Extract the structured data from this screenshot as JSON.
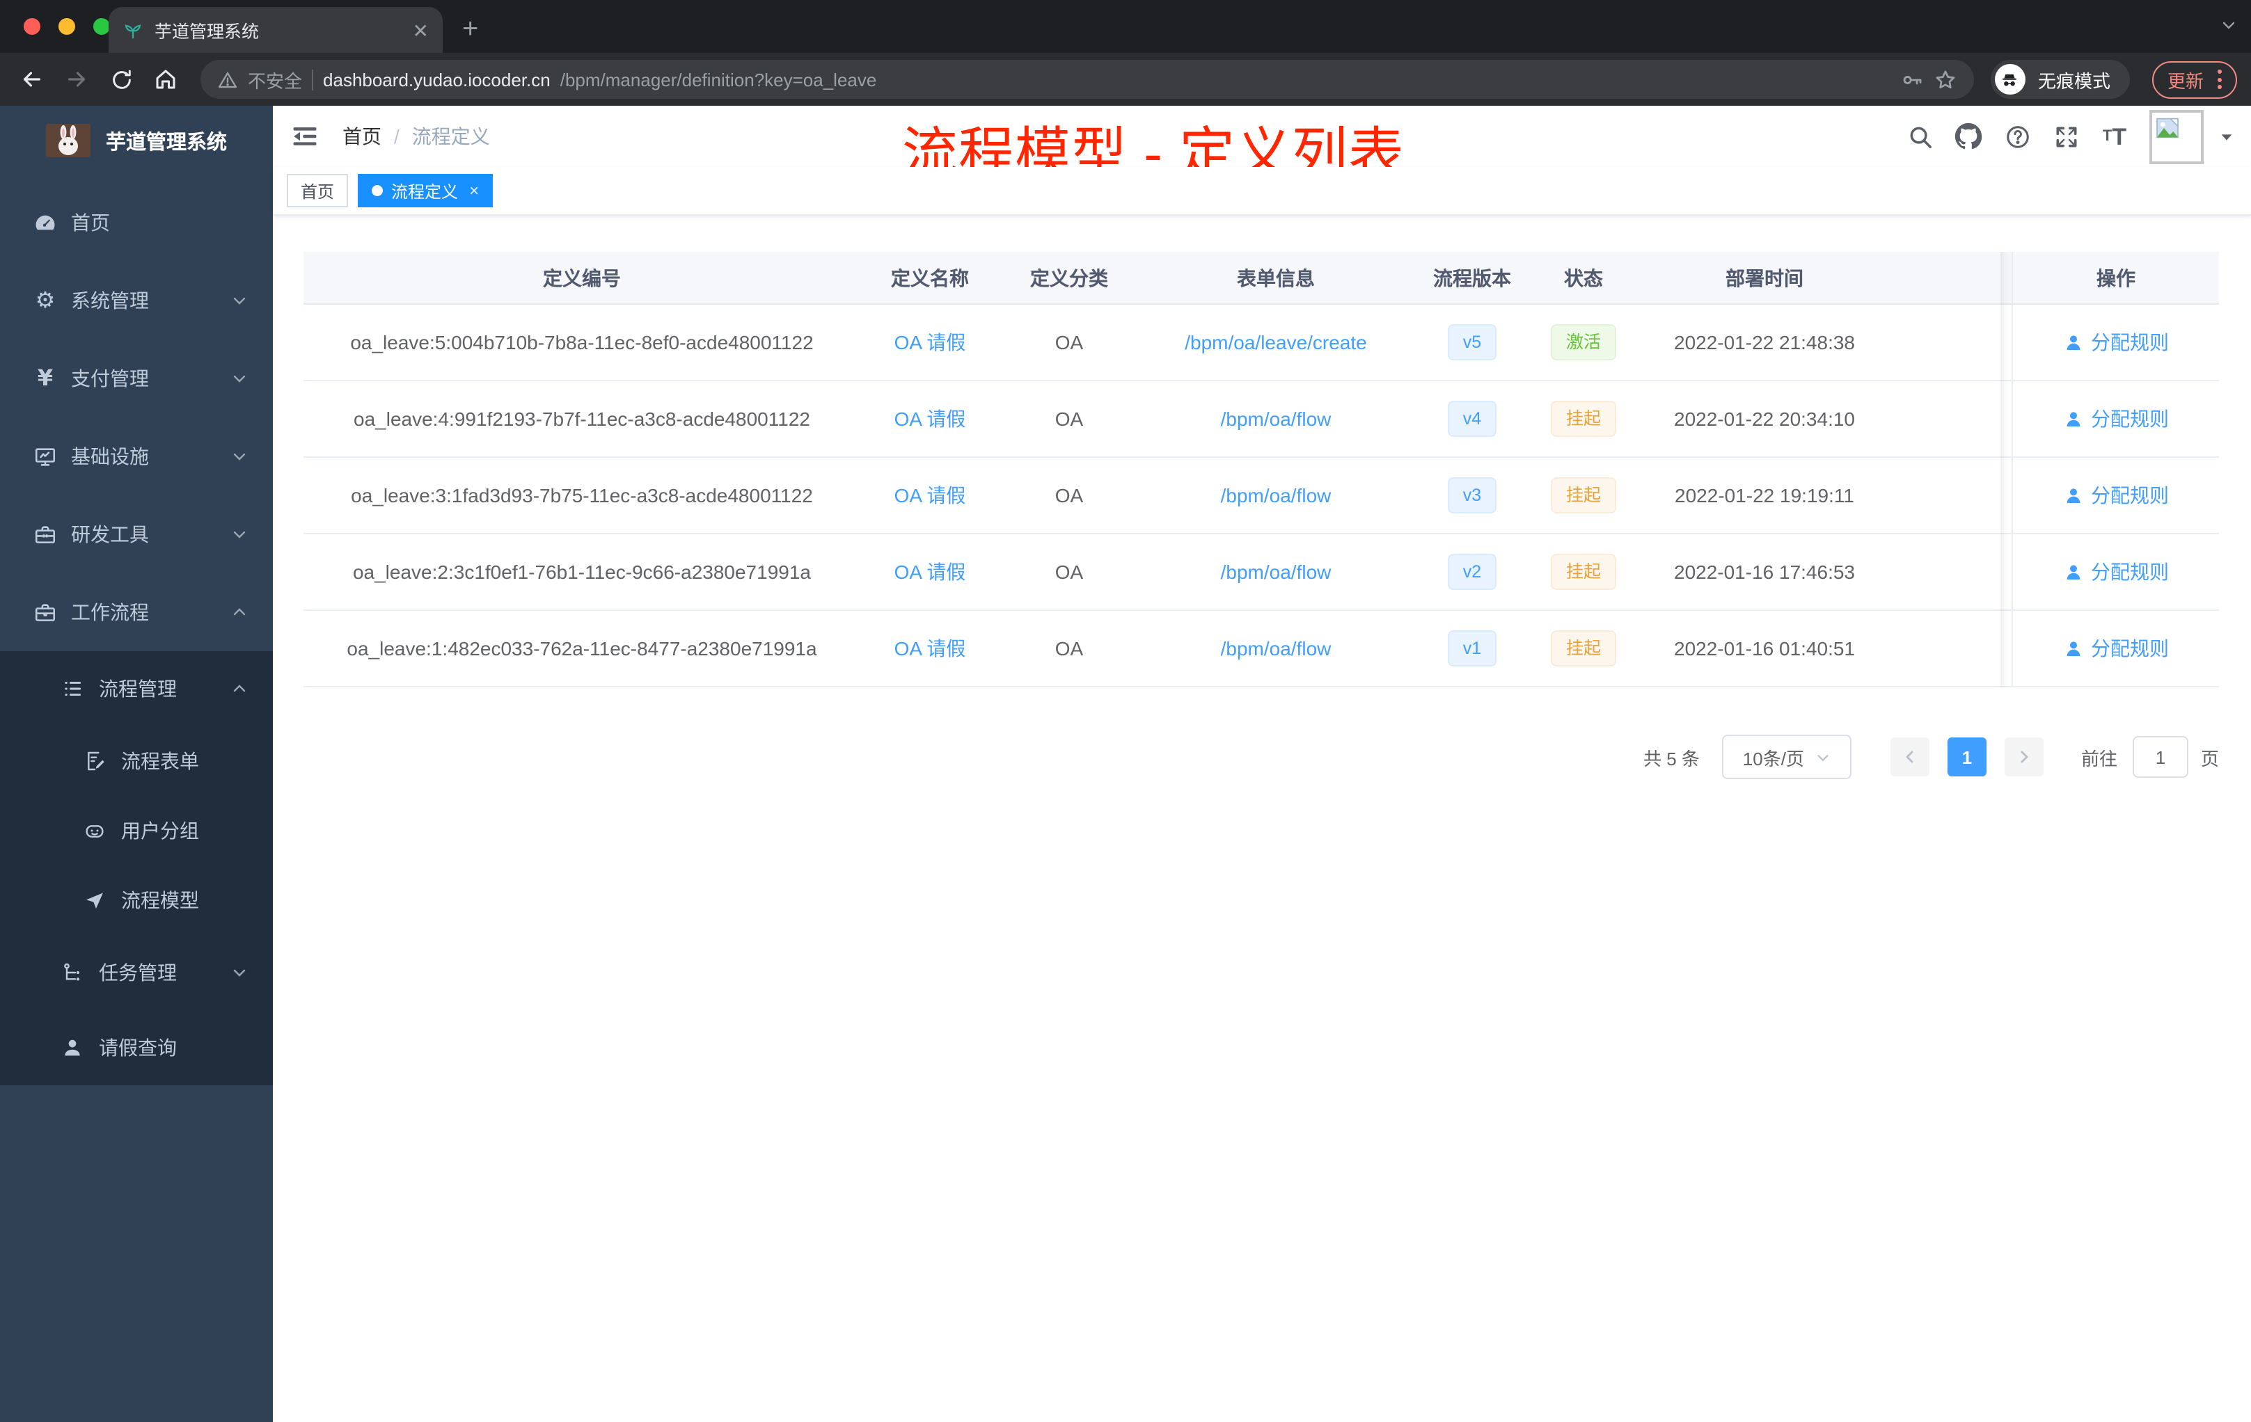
{
  "browser": {
    "tab_title": "芋道管理系统",
    "close_tab": "✕",
    "new_tab": "+",
    "address": {
      "security_label": "不安全",
      "host": "dashboard.yudao.iocoder.cn",
      "path": "/bpm/manager/definition?key=oa_leave"
    },
    "incognito_label": "无痕模式",
    "update_label": "更新"
  },
  "sidebar": {
    "logo_title": "芋道管理系统",
    "home": "首页",
    "system": "系统管理",
    "payment": "支付管理",
    "infra": "基础设施",
    "devtools": "研发工具",
    "workflow": "工作流程",
    "process_mgmt": "流程管理",
    "process_form": "流程表单",
    "user_group": "用户分组",
    "process_model": "流程模型",
    "task_mgmt": "任务管理",
    "leave_query": "请假查询"
  },
  "header": {
    "breadcrumb_home": "首页",
    "breadcrumb_sep": "/",
    "breadcrumb_current": "流程定义",
    "annotation": "流程模型 - 定义列表"
  },
  "tags": {
    "home": "首页",
    "active": "流程定义",
    "close": "×"
  },
  "table": {
    "columns": {
      "id": "定义编号",
      "name": "定义名称",
      "category": "定义分类",
      "form": "表单信息",
      "version": "流程版本",
      "status": "状态",
      "deploy_time": "部署时间",
      "actions": "操作"
    },
    "rows": [
      {
        "id": "oa_leave:5:004b710b-7b8a-11ec-8ef0-acde48001122",
        "name": "OA 请假",
        "category": "OA",
        "form": "/bpm/oa/leave/create",
        "version": "v5",
        "status": "激活",
        "deploy_time": "2022-01-22 21:48:38",
        "action": "分配规则"
      },
      {
        "id": "oa_leave:4:991f2193-7b7f-11ec-a3c8-acde48001122",
        "name": "OA 请假",
        "category": "OA",
        "form": "/bpm/oa/flow",
        "version": "v4",
        "status": "挂起",
        "deploy_time": "2022-01-22 20:34:10",
        "action": "分配规则"
      },
      {
        "id": "oa_leave:3:1fad3d93-7b75-11ec-a3c8-acde48001122",
        "name": "OA 请假",
        "category": "OA",
        "form": "/bpm/oa/flow",
        "version": "v3",
        "status": "挂起",
        "deploy_time": "2022-01-22 19:19:11",
        "action": "分配规则"
      },
      {
        "id": "oa_leave:2:3c1f0ef1-76b1-11ec-9c66-a2380e71991a",
        "name": "OA 请假",
        "category": "OA",
        "form": "/bpm/oa/flow",
        "version": "v2",
        "status": "挂起",
        "deploy_time": "2022-01-16 17:46:53",
        "action": "分配规则"
      },
      {
        "id": "oa_leave:1:482ec033-762a-11ec-8477-a2380e71991a",
        "name": "OA 请假",
        "category": "OA",
        "form": "/bpm/oa/flow",
        "version": "v1",
        "status": "挂起",
        "deploy_time": "2022-01-16 01:40:51",
        "action": "分配规则"
      }
    ]
  },
  "pagination": {
    "total": "共 5 条",
    "page_size": "10条/页",
    "current_page": "1",
    "goto_label": "前往",
    "goto_value": "1",
    "unit_label": "页"
  },
  "colors": {
    "accent": "#409eff",
    "tag_active": "#1890ff",
    "success": "#67c23a",
    "warning": "#e6a23c",
    "annotation_red": "#ff2600",
    "sidebar_bg": "#304156",
    "submenu_bg": "#1f2d3d"
  }
}
